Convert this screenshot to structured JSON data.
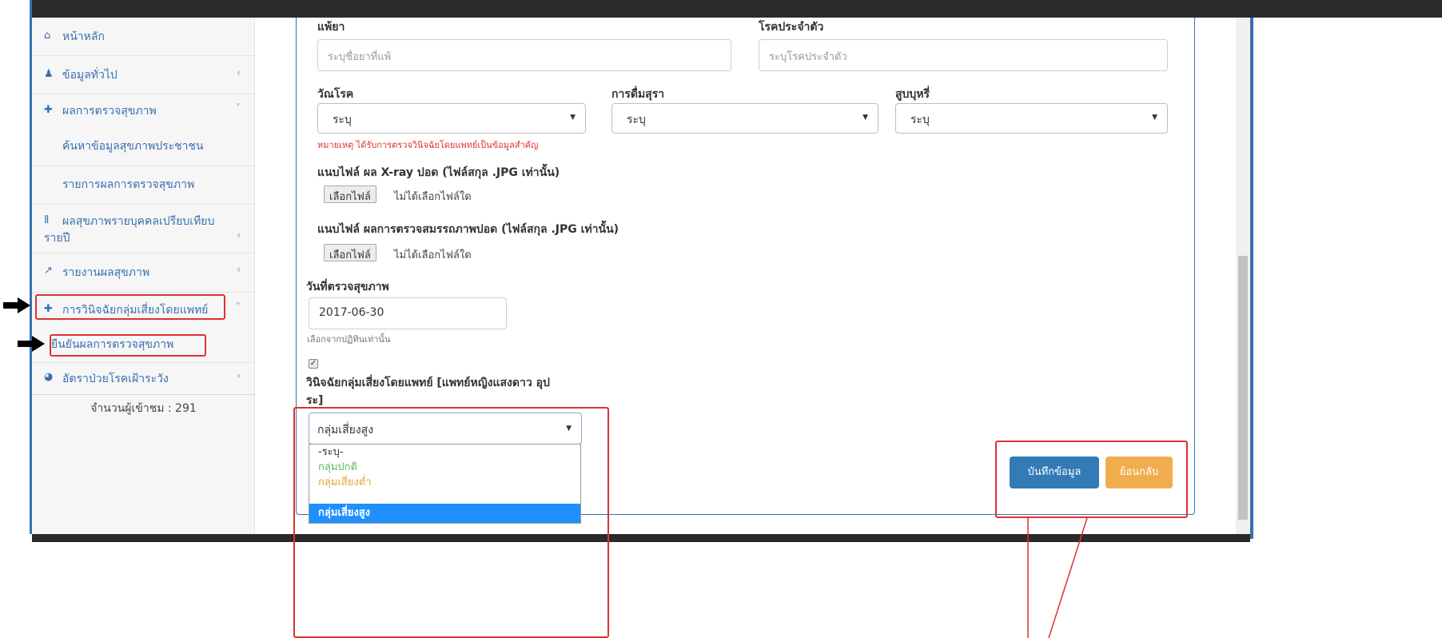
{
  "sidebar": {
    "items": [
      {
        "label": "หน้าหลัก",
        "icon": "home-icon",
        "glyph": "⌂",
        "chevron": ""
      },
      {
        "label": "ข้อมูลทั่วไป",
        "icon": "user-icon",
        "glyph": "♟",
        "chevron": "‹"
      },
      {
        "label": "ผลการตรวจสุขภาพ",
        "icon": "medkit-icon",
        "glyph": "✚",
        "chevron": "˅"
      },
      {
        "label": "ผลสุขภาพรายบุคคลเปรียบเทียบ",
        "label2": "รายปี",
        "icon": "bar-chart-icon",
        "glyph": "Ⅱ",
        "chevron": "‹"
      },
      {
        "label": "รายงานผลสุขภาพ",
        "icon": "line-chart-icon",
        "glyph": "↗",
        "chevron": "‹"
      },
      {
        "label": "การวินิจฉัยกลุ่มเสี่ยงโดยแพทย์",
        "icon": "medkit-icon",
        "glyph": "✚",
        "chevron": "˅"
      },
      {
        "label": "อัตราป่วยโรคเฝ้าระวัง",
        "icon": "pie-chart-icon",
        "glyph": "◕",
        "chevron": "‹"
      }
    ],
    "sub_health": [
      "ค้นหาข้อมูลสุขภาพประชาชน",
      "รายการผลการตรวจสุขภาพ"
    ],
    "sub_diagnosis": [
      "ยืนยันผลการตรวจสุขภาพ"
    ],
    "visitor_count": "จำนวนผู้เข้าชม : 291"
  },
  "form": {
    "allergy_label": "แพ้ยา",
    "allergy_placeholder": "ระบุชื่อยาที่แพ้",
    "disease_label": "โรคประจำตัว",
    "disease_placeholder": "ระบุโรคประจำตัว",
    "tb_label": "วัณโรค",
    "tb_value": "ระบุ",
    "alcohol_label": "การดื่มสุรา",
    "alcohol_value": "ระบุ",
    "smoking_label": "สูบบุหรี่",
    "smoking_value": "ระบุ",
    "note": "หมายเหตุ ได้รับการตรวจวินิจฉัยโดยแพทย์เป็นข้อมูลสำคัญ",
    "xray_label": "แนบไฟล์ ผล X-ray ปอด (ไฟล์สกุล .JPG เท่านั้น)",
    "xray_button": "เลือกไฟล์",
    "xray_status": "ไม่ได้เลือกไฟล์ใด",
    "lung_label": "แนบไฟล์ ผลการตรวจสมรรถภาพปอด (ไฟล์สกุล .JPG เท่านั้น)",
    "lung_button": "เลือกไฟล์",
    "lung_status": "ไม่ได้เลือกไฟล์ใด",
    "date_label": "วันที่ตรวจสุขภาพ",
    "date_value": "2017-06-30",
    "date_hint": "เลือกจากปฏิทินเท่านั้น",
    "checkbox_checked": true,
    "diag_label_1": "วินิจฉัยกลุ่มเสี่ยงโดยแพทย์ [แพทย์หญิงแสงดาว อุป",
    "diag_label_2": "ระ]",
    "risk_value": "กลุ่มเสี่ยงสูง",
    "risk_options": [
      "-ระบุ-",
      "กลุ่มปกติ",
      "กลุ่มเสี่ยงต่ำ",
      "กลุ่มเสี่ยงสูง"
    ],
    "save_button": "บันทึกข้อมูล",
    "back_button": "ย้อนกลับ"
  },
  "colors": {
    "accent": "#3a6fb0",
    "annotation": "#e03131",
    "save": "#337ab7",
    "back": "#f0ad4e",
    "option_normal": "#5cb85c",
    "option_low": "#e5a632",
    "option_selected_bg": "#1e90ff"
  }
}
